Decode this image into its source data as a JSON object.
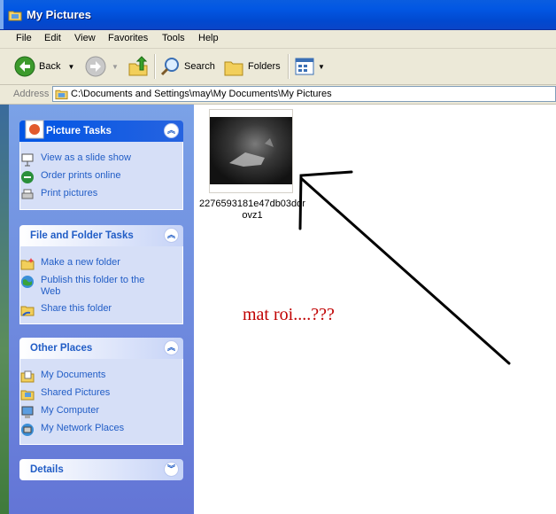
{
  "window": {
    "title": "My Pictures",
    "title_icon": "folder-icon"
  },
  "menu": [
    "File",
    "Edit",
    "View",
    "Favorites",
    "Tools",
    "Help"
  ],
  "toolbar": {
    "back_label": "Back",
    "search_label": "Search",
    "folders_label": "Folders"
  },
  "address": {
    "label": "Address",
    "value": "C:\\Documents and Settings\\may\\My Documents\\My Pictures"
  },
  "panels": {
    "picture_tasks": {
      "title": "Picture Tasks",
      "items": [
        "View as a slide show",
        "Order prints online",
        "Print pictures"
      ]
    },
    "file_folder_tasks": {
      "title": "File and Folder Tasks",
      "items": [
        "Make a new folder",
        "Publish this folder to the Web",
        "Share this folder"
      ]
    },
    "other_places": {
      "title": "Other Places",
      "items": [
        "My Documents",
        "Shared Pictures",
        "My Computer",
        "My Network Places"
      ]
    },
    "details": {
      "title": "Details"
    }
  },
  "content": {
    "file": {
      "name_line1": "2276593181e47db03ddr",
      "name_line2": "ovz1"
    },
    "annotation": "mat roi....???"
  },
  "colors": {
    "link": "#215dc6",
    "titlebar": "#0257e3",
    "annotation": "#c00000"
  }
}
